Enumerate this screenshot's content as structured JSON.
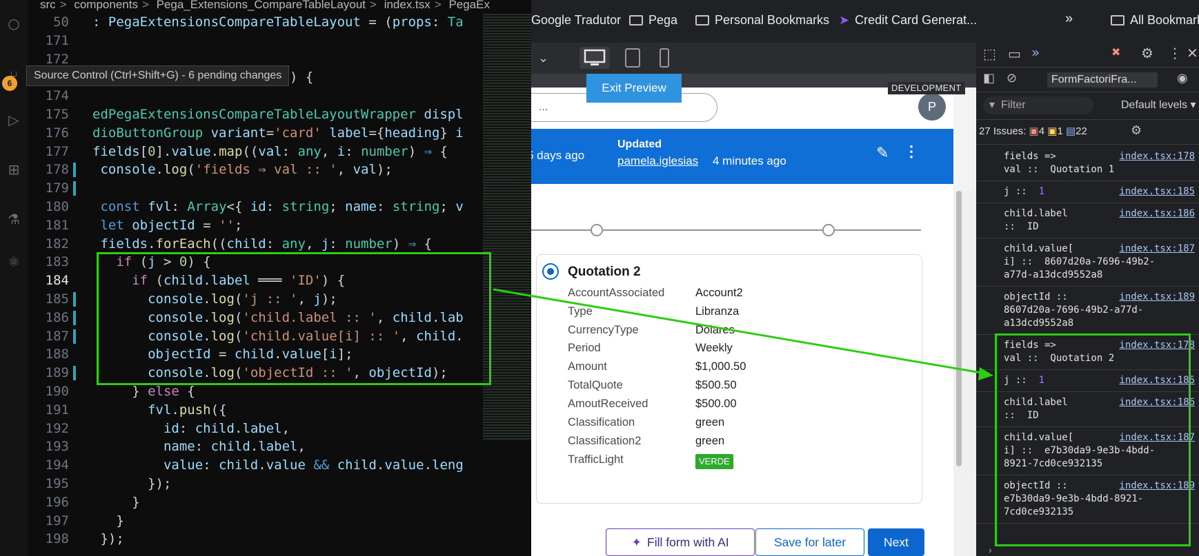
{
  "editor": {
    "breadcrumb": [
      "src",
      "components",
      "Pega_Extensions_CompareTableLayout",
      "index.tsx",
      "PegaEx"
    ],
    "tooltip": "Source Control (Ctrl+Shift+G) - 6 pending changes",
    "source_control_badge": "6",
    "lines": [
      {
        "n": "50",
        "html": "<span class='v'>: PegaExtensionsCompareTableLayout</span> = (<span class='v'>props</span>: <span class='t'>Ta</span>"
      },
      {
        "n": "171",
        "html": ""
      },
      {
        "n": "172",
        "html": ""
      },
      {
        "n": "173",
        "html": "                   <span class='s'>-card'</span>) {"
      },
      {
        "n": "174",
        "html": ""
      },
      {
        "n": "175",
        "html": "<span class='t'>edPegaExtensionsCompareTableLayoutWrapper</span> <span class='v'>displ</span>"
      },
      {
        "n": "176",
        "html": "<span class='t'>dioButtonGroup</span> <span class='v'>variant</span>=<span class='s'>'card'</span> <span class='v'>label</span>={<span class='v'>heading</span>} <span class='v'>i</span>"
      },
      {
        "n": "177",
        "html": "<span class='v'>fields</span>[<span class='n'>0</span>].<span class='v'>value</span>.<span class='f'>map</span>((<span class='v'>val</span>: <span class='t'>any</span>, <span class='v'>i</span>: <span class='t'>number</span>) <span class='kb'>⇒</span> {"
      },
      {
        "n": "178",
        "html": " <span class='v'>console</span>.<span class='f'>log</span>(<span class='s'>'fields ⇒ val :: '</span>, <span class='v'>val</span>);",
        "mark": true
      },
      {
        "n": "179",
        "html": "",
        "mark": true
      },
      {
        "n": "180",
        "html": " <span class='kb'>const</span> <span class='v'>fvl</span>: <span class='t'>Array</span>&lt;{ <span class='v'>id</span>: <span class='t'>string</span>; <span class='v'>name</span>: <span class='t'>string</span>; <span class='v'>v</span>"
      },
      {
        "n": "181",
        "html": " <span class='kb'>let</span> <span class='v'>objectId</span> = <span class='s'>''</span>;"
      },
      {
        "n": "182",
        "html": " <span class='v'>fields</span>.<span class='f'>forEach</span>((<span class='v'>child</span>: <span class='t'>any</span>, <span class='v'>j</span>: <span class='t'>number</span>) <span class='kb'>⇒</span> {"
      },
      {
        "n": "183",
        "html": "   <span class='k'>if</span> (<span class='v'>j</span> &gt; <span class='n'>0</span>) {"
      },
      {
        "n": "184",
        "html": "     <span class='k'>if</span> (<span class='v'>child</span>.<span class='v'>label</span> ═══ <span class='s'>'ID'</span>) {",
        "current": true
      },
      {
        "n": "185",
        "html": "       <span class='v'>console</span>.<span class='f'>log</span>(<span class='s'>'j :: '</span>, <span class='v'>j</span>);",
        "mark": true
      },
      {
        "n": "186",
        "html": "       <span class='v'>console</span>.<span class='f'>log</span>(<span class='s'>'child.label :: '</span>, <span class='v'>child</span>.<span class='v'>lab</span>",
        "mark": true
      },
      {
        "n": "187",
        "html": "       <span class='v'>console</span>.<span class='f'>log</span>(<span class='s'>'child.value[i] :: '</span>, <span class='v'>child</span>.",
        "mark": true
      },
      {
        "n": "188",
        "html": "       <span class='v'>objectId</span> = <span class='v'>child</span>.<span class='v'>value</span>[<span class='v'>i</span>];"
      },
      {
        "n": "189",
        "html": "       <span class='v'>console</span>.<span class='f'>log</span>(<span class='s'>'objectId :: '</span>, <span class='v'>objectId</span>);",
        "mark": true
      },
      {
        "n": "190",
        "html": "     } <span class='k'>else</span> {"
      },
      {
        "n": "191",
        "html": "       <span class='v'>fvl</span>.<span class='f'>push</span>({"
      },
      {
        "n": "192",
        "html": "         <span class='v'>id</span>: <span class='v'>child</span>.<span class='v'>label</span>,"
      },
      {
        "n": "193",
        "html": "         <span class='v'>name</span>: <span class='v'>child</span>.<span class='v'>label</span>,"
      },
      {
        "n": "194",
        "html": "         <span class='v'>value</span>: <span class='v'>child</span>.<span class='v'>value</span> <span class='kb'>&amp;&amp;</span> <span class='v'>child</span>.<span class='v'>value</span>.<span class='v'>leng</span>"
      },
      {
        "n": "195",
        "html": "       });"
      },
      {
        "n": "196",
        "html": "     }"
      },
      {
        "n": "197",
        "html": "   }"
      },
      {
        "n": "198",
        "html": " });"
      }
    ]
  },
  "bookmarks": {
    "items": [
      "Google Tradutor",
      "Pega",
      "Personal Bookmarks",
      "Credit Card Generat..."
    ],
    "overflow": "»",
    "all": "All Bookmark"
  },
  "preview": {
    "exit_label": "Exit Preview",
    "env_label": "DEVELOPMENT",
    "search_placeholder": "..."
  },
  "case": {
    "avatar_initial": "P",
    "created_ago": "5 days ago",
    "updated_heading": "Updated",
    "updated_by": "pamela.iglesias",
    "updated_ago": "4 minutes ago"
  },
  "quotation": {
    "title": "Quotation 2",
    "rows": [
      {
        "label": "AccountAssociated",
        "value": "Account2"
      },
      {
        "label": "Type",
        "value": "Libranza"
      },
      {
        "label": "CurrencyType",
        "value": "Dólares"
      },
      {
        "label": "Period",
        "value": "Weekly"
      },
      {
        "label": "Amount",
        "value": "$1,000.50"
      },
      {
        "label": "TotalQuote",
        "value": "$500.50"
      },
      {
        "label": "AmoutReceived",
        "value": "$500.00"
      },
      {
        "label": "Classification",
        "value": "green"
      },
      {
        "label": "Classification2",
        "value": "green"
      },
      {
        "label": "TrafficLight",
        "value": "VERDE"
      }
    ]
  },
  "actions": {
    "fill_ai": "Fill form with AI",
    "save_later": "Save for later",
    "next": "Next"
  },
  "devtools": {
    "context": "FormFactoriFra...",
    "filter_placeholder": "Filter",
    "levels": "Default levels",
    "issues_label": "27 Issues:",
    "issues_errors": "4",
    "issues_warnings": "1",
    "issues_info": "22",
    "logs": [
      {
        "text": "fields =>\nval ::  Quotation 1",
        "src": "index.tsx:178"
      },
      {
        "text": "j ::  ",
        "num": "1",
        "src": "index.tsx:185"
      },
      {
        "text": "child.label\n::  ID",
        "src": "index.tsx:186"
      },
      {
        "text": "child.value[\ni] ::  8607d20a-7696-49b2-\na77d-a13dcd9552a8",
        "src": "index.tsx:187"
      },
      {
        "text": "objectId ::\n8607d20a-7696-49b2-a77d-\na13dcd9552a8",
        "src": "index.tsx:189"
      },
      {
        "text": "fields =>\nval ::  Quotation 2",
        "src": "index.tsx:178"
      },
      {
        "text": "j ::  ",
        "num": "1",
        "src": "index.tsx:185"
      },
      {
        "text": "child.label\n::  ID",
        "src": "index.tsx:186"
      },
      {
        "text": "child.value[\ni] ::  e7b30da9-9e3b-4bdd-\n8921-7cd0ce932135",
        "src": "index.tsx:187"
      },
      {
        "text": "objectId ::\ne7b30da9-9e3b-4bdd-8921-\n7cd0ce932135",
        "src": "index.tsx:189"
      }
    ]
  },
  "colors": {
    "highlight": "#2ecc14",
    "banner": "#0f6fd6",
    "primary": "#0b66cf"
  }
}
